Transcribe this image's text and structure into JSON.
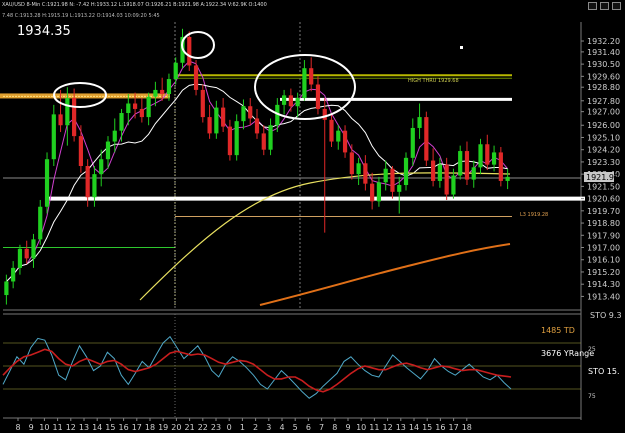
{
  "header": {
    "symbol_line": "XAU/USD 8-Min  C:1921.98  N: -7.42  H:1933.12  L:1918.07  O:1926.21  B:1921.98  A:1922.34  V:62.9K  O:1400",
    "sub_line": "7.48  C:1913.28  H:1915.19  L:1913.22  O:1914.03  10:09:20  5:45",
    "big_price": "1934.35",
    "current_price_tag": "1921.98"
  },
  "annotations": {
    "upper_line_label": "HIGH THRU 1929.68",
    "lower_line_label": "L3 1919.28"
  },
  "chart_data": [
    {
      "type": "candlestick",
      "title": "XAU/USD 8-Min",
      "y_ticks": [
        1932.2,
        1931.4,
        1930.5,
        1929.6,
        1928.8,
        1927.8,
        1927.0,
        1926.0,
        1925.1,
        1924.2,
        1923.3,
        1922.4,
        1921.5,
        1920.6,
        1919.7,
        1918.8,
        1917.9,
        1917.0,
        1916.1,
        1915.2,
        1914.3,
        1913.4
      ],
      "ylim": [
        1912.4,
        1933.6
      ],
      "x_ticks": [
        "8",
        "9",
        "10",
        "11",
        "12",
        "13",
        "14",
        "15",
        "16",
        "17",
        "18",
        "19",
        "20",
        "21",
        "22",
        "23",
        "0",
        "1",
        "2",
        "3",
        "4",
        "5",
        "6",
        "7",
        "8",
        "9",
        "10",
        "11",
        "12",
        "13",
        "14",
        "15",
        "16",
        "17",
        "18"
      ],
      "candles": [
        [
          1913.5,
          1915.0,
          1912.8,
          1914.5
        ],
        [
          1914.5,
          1916.0,
          1914.0,
          1915.5
        ],
        [
          1915.5,
          1917.2,
          1915.0,
          1916.9
        ],
        [
          1916.9,
          1917.5,
          1915.8,
          1916.2
        ],
        [
          1916.2,
          1918.0,
          1915.5,
          1917.6
        ],
        [
          1917.6,
          1920.5,
          1917.2,
          1920.0
        ],
        [
          1920.0,
          1924.0,
          1919.5,
          1923.5
        ],
        [
          1923.5,
          1927.5,
          1923.0,
          1926.8
        ],
        [
          1926.8,
          1928.6,
          1925.5,
          1926.0
        ],
        [
          1926.0,
          1928.8,
          1924.5,
          1928.0
        ],
        [
          1928.0,
          1928.7,
          1924.8,
          1925.2
        ],
        [
          1925.2,
          1926.0,
          1922.5,
          1923.0
        ],
        [
          1923.0,
          1923.5,
          1920.0,
          1920.7
        ],
        [
          1920.7,
          1923.0,
          1920.0,
          1922.4
        ],
        [
          1922.4,
          1924.2,
          1921.5,
          1923.5
        ],
        [
          1923.5,
          1925.2,
          1922.8,
          1924.8
        ],
        [
          1924.8,
          1926.5,
          1924.0,
          1925.6
        ],
        [
          1925.6,
          1927.2,
          1924.8,
          1926.9
        ],
        [
          1926.9,
          1928.3,
          1926.0,
          1927.6
        ],
        [
          1927.6,
          1928.4,
          1926.5,
          1927.2
        ],
        [
          1927.2,
          1928.0,
          1926.2,
          1926.6
        ],
        [
          1926.6,
          1928.4,
          1926.0,
          1928.1
        ],
        [
          1928.1,
          1929.2,
          1927.4,
          1928.6
        ],
        [
          1928.6,
          1929.5,
          1927.8,
          1928.3
        ],
        [
          1928.3,
          1929.8,
          1927.8,
          1929.4
        ],
        [
          1929.4,
          1931.0,
          1929.0,
          1930.6
        ],
        [
          1930.6,
          1933.1,
          1930.2,
          1932.5
        ],
        [
          1932.5,
          1932.9,
          1930.0,
          1930.4
        ],
        [
          1930.4,
          1930.8,
          1928.2,
          1928.6
        ],
        [
          1928.6,
          1929.0,
          1926.2,
          1926.6
        ],
        [
          1926.6,
          1927.5,
          1925.0,
          1925.4
        ],
        [
          1925.4,
          1927.8,
          1925.0,
          1927.3
        ],
        [
          1927.3,
          1928.0,
          1925.5,
          1925.9
        ],
        [
          1925.9,
          1926.4,
          1923.4,
          1923.8
        ],
        [
          1923.8,
          1926.8,
          1923.4,
          1926.3
        ],
        [
          1926.3,
          1927.9,
          1925.7,
          1927.4
        ],
        [
          1927.4,
          1928.0,
          1926.0,
          1926.5
        ],
        [
          1926.5,
          1927.2,
          1925.0,
          1925.4
        ],
        [
          1925.4,
          1926.0,
          1923.8,
          1924.2
        ],
        [
          1924.2,
          1926.5,
          1923.8,
          1926.0
        ],
        [
          1926.0,
          1928.0,
          1925.5,
          1927.5
        ],
        [
          1927.5,
          1928.6,
          1926.8,
          1928.2
        ],
        [
          1928.2,
          1928.7,
          1927.0,
          1927.4
        ],
        [
          1927.4,
          1928.4,
          1926.6,
          1928.0
        ],
        [
          1928.0,
          1930.8,
          1927.8,
          1930.2
        ],
        [
          1930.2,
          1931.0,
          1928.5,
          1929.0
        ],
        [
          1929.0,
          1929.6,
          1926.8,
          1927.2
        ],
        [
          1927.2,
          1928.0,
          1918.1,
          1926.4
        ],
        [
          1926.4,
          1926.9,
          1924.4,
          1924.8
        ],
        [
          1924.8,
          1926.0,
          1924.2,
          1925.6
        ],
        [
          1925.6,
          1926.0,
          1923.6,
          1924.0
        ],
        [
          1924.0,
          1924.6,
          1922.0,
          1922.4
        ],
        [
          1922.4,
          1923.6,
          1921.6,
          1923.2
        ],
        [
          1923.2,
          1923.8,
          1921.2,
          1921.7
        ],
        [
          1921.7,
          1922.5,
          1919.8,
          1920.4
        ],
        [
          1920.4,
          1922.2,
          1920.0,
          1921.8
        ],
        [
          1921.8,
          1923.4,
          1921.2,
          1922.8
        ],
        [
          1922.8,
          1923.0,
          1920.6,
          1921.1
        ],
        [
          1921.1,
          1922.2,
          1919.5,
          1921.6
        ],
        [
          1921.6,
          1924.0,
          1921.2,
          1923.6
        ],
        [
          1923.6,
          1926.5,
          1923.0,
          1925.8
        ],
        [
          1925.8,
          1927.6,
          1925.0,
          1926.6
        ],
        [
          1926.6,
          1927.0,
          1923.0,
          1923.4
        ],
        [
          1923.4,
          1924.3,
          1921.5,
          1921.9
        ],
        [
          1921.9,
          1923.6,
          1921.4,
          1923.1
        ],
        [
          1923.1,
          1923.6,
          1920.5,
          1920.9
        ],
        [
          1920.9,
          1922.8,
          1920.6,
          1922.3
        ],
        [
          1922.3,
          1924.5,
          1922.0,
          1924.1
        ],
        [
          1924.1,
          1924.8,
          1921.6,
          1922.0
        ],
        [
          1922.0,
          1923.4,
          1921.4,
          1922.9
        ],
        [
          1922.9,
          1925.0,
          1922.4,
          1924.6
        ],
        [
          1924.6,
          1925.3,
          1922.7,
          1923.1
        ],
        [
          1923.1,
          1924.5,
          1922.6,
          1924.0
        ],
        [
          1924.0,
          1924.4,
          1921.5,
          1921.9
        ],
        [
          1921.9,
          1922.8,
          1921.3,
          1922.2
        ]
      ],
      "levels": {
        "upper_resistance": 1929.68,
        "white_upper": 1927.9,
        "white_lower": 1920.6,
        "l3_support": 1919.28,
        "green_line": 1917.0
      }
    },
    {
      "type": "line",
      "title": "STO",
      "series": [
        {
          "name": "",
          "color": "#4fa8c8",
          "values": [
            30,
            45,
            60,
            52,
            70,
            80,
            78,
            62,
            40,
            35,
            55,
            72,
            60,
            45,
            50,
            65,
            58,
            40,
            30,
            42,
            55,
            48,
            62,
            75,
            82,
            70,
            58,
            65,
            72,
            60,
            45,
            38,
            52,
            60,
            55,
            48,
            40,
            30,
            25,
            35,
            45,
            38,
            30,
            22,
            15,
            20,
            28,
            35,
            42,
            55,
            60,
            52,
            45,
            40,
            38,
            50,
            62,
            55,
            48,
            42,
            36,
            45,
            58,
            50,
            44,
            40,
            46,
            52,
            45,
            38,
            35,
            40,
            32,
            25
          ]
        },
        {
          "name": "",
          "color": "#c81e1e",
          "values": [
            40,
            48,
            55,
            60,
            62,
            65,
            68,
            66,
            58,
            52,
            50,
            55,
            58,
            55,
            52,
            55,
            56,
            52,
            46,
            44,
            46,
            48,
            52,
            58,
            64,
            66,
            64,
            62,
            63,
            62,
            58,
            54,
            52,
            54,
            56,
            55,
            52,
            46,
            40,
            36,
            36,
            38,
            38,
            34,
            28,
            24,
            22,
            25,
            30,
            36,
            42,
            47,
            50,
            48,
            46,
            46,
            49,
            52,
            53,
            51,
            48,
            46,
            48,
            50,
            49,
            47,
            45,
            46,
            46,
            44,
            42,
            40,
            39,
            38
          ]
        }
      ],
      "right_labels": {
        "td": "1485 TD",
        "yrange": "3676 YRange",
        "sto_top": "STO  9.3",
        "sto_bottom": "STO  15."
      },
      "y_ticks": [
        "25",
        "75"
      ]
    }
  ]
}
